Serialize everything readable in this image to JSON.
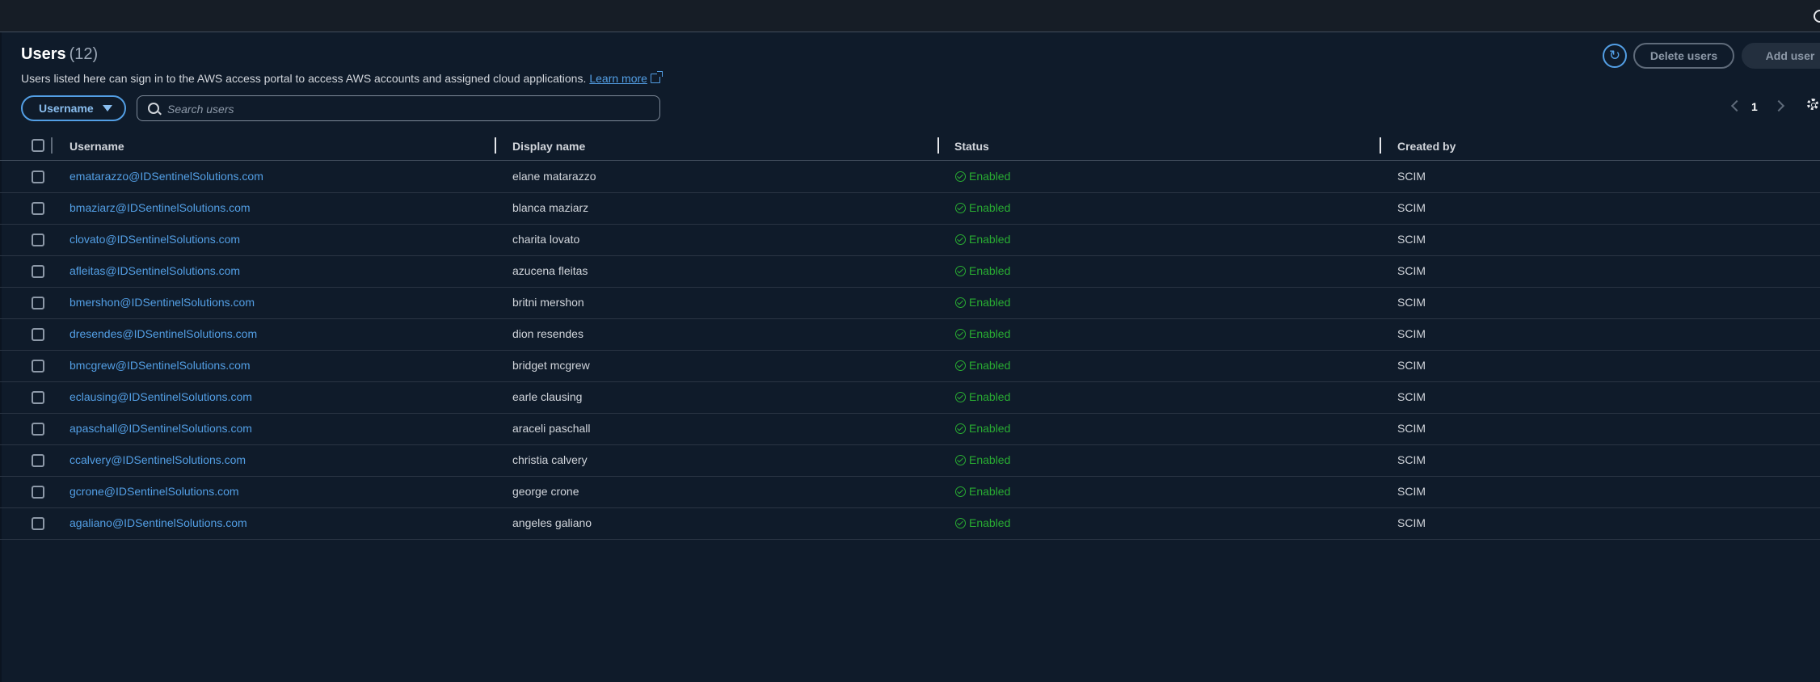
{
  "header": {
    "title": "Users",
    "count": "(12)",
    "description": "Users listed here can sign in to the AWS access portal to access AWS accounts and assigned cloud applications.",
    "learn_more": "Learn more"
  },
  "actions": {
    "delete_label": "Delete users",
    "add_label": "Add user"
  },
  "filter": {
    "property_label": "Username",
    "search_placeholder": "Search users"
  },
  "pagination": {
    "current_page": "1"
  },
  "table": {
    "columns": [
      "Username",
      "Display name",
      "Status",
      "Created by"
    ],
    "rows": [
      {
        "username": "ematarazzo@IDSentinelSolutions.com",
        "display_name": "elane matarazzo",
        "status": "Enabled",
        "created_by": "SCIM"
      },
      {
        "username": "bmaziarz@IDSentinelSolutions.com",
        "display_name": "blanca maziarz",
        "status": "Enabled",
        "created_by": "SCIM"
      },
      {
        "username": "clovato@IDSentinelSolutions.com",
        "display_name": "charita lovato",
        "status": "Enabled",
        "created_by": "SCIM"
      },
      {
        "username": "afleitas@IDSentinelSolutions.com",
        "display_name": "azucena fleitas",
        "status": "Enabled",
        "created_by": "SCIM"
      },
      {
        "username": "bmershon@IDSentinelSolutions.com",
        "display_name": "britni mershon",
        "status": "Enabled",
        "created_by": "SCIM"
      },
      {
        "username": "dresendes@IDSentinelSolutions.com",
        "display_name": "dion resendes",
        "status": "Enabled",
        "created_by": "SCIM"
      },
      {
        "username": "bmcgrew@IDSentinelSolutions.com",
        "display_name": "bridget mcgrew",
        "status": "Enabled",
        "created_by": "SCIM"
      },
      {
        "username": "eclausing@IDSentinelSolutions.com",
        "display_name": "earle clausing",
        "status": "Enabled",
        "created_by": "SCIM"
      },
      {
        "username": "apaschall@IDSentinelSolutions.com",
        "display_name": "araceli paschall",
        "status": "Enabled",
        "created_by": "SCIM"
      },
      {
        "username": "ccalvery@IDSentinelSolutions.com",
        "display_name": "christia calvery",
        "status": "Enabled",
        "created_by": "SCIM"
      },
      {
        "username": "gcrone@IDSentinelSolutions.com",
        "display_name": "george crone",
        "status": "Enabled",
        "created_by": "SCIM"
      },
      {
        "username": "agaliano@IDSentinelSolutions.com",
        "display_name": "angeles galiano",
        "status": "Enabled",
        "created_by": "SCIM"
      }
    ]
  },
  "colors": {
    "background": "#0f1b2a",
    "link": "#539fe5",
    "status_enabled": "#29ad32"
  },
  "icons": [
    "info-icon",
    "refresh-icon",
    "external-link-icon",
    "caret-down-icon",
    "search-icon",
    "chevron-left-icon",
    "chevron-right-icon",
    "gear-icon",
    "check-circle-icon"
  ]
}
